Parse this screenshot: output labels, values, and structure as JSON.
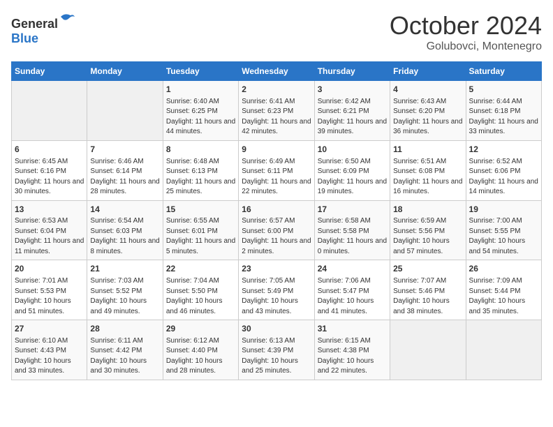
{
  "header": {
    "logo_general": "General",
    "logo_blue": "Blue",
    "month_title": "October 2024",
    "subtitle": "Golubovci, Montenegro"
  },
  "weekdays": [
    "Sunday",
    "Monday",
    "Tuesday",
    "Wednesday",
    "Thursday",
    "Friday",
    "Saturday"
  ],
  "weeks": [
    [
      {
        "day": "",
        "info": ""
      },
      {
        "day": "",
        "info": ""
      },
      {
        "day": "1",
        "info": "Sunrise: 6:40 AM\nSunset: 6:25 PM\nDaylight: 11 hours and 44 minutes."
      },
      {
        "day": "2",
        "info": "Sunrise: 6:41 AM\nSunset: 6:23 PM\nDaylight: 11 hours and 42 minutes."
      },
      {
        "day": "3",
        "info": "Sunrise: 6:42 AM\nSunset: 6:21 PM\nDaylight: 11 hours and 39 minutes."
      },
      {
        "day": "4",
        "info": "Sunrise: 6:43 AM\nSunset: 6:20 PM\nDaylight: 11 hours and 36 minutes."
      },
      {
        "day": "5",
        "info": "Sunrise: 6:44 AM\nSunset: 6:18 PM\nDaylight: 11 hours and 33 minutes."
      }
    ],
    [
      {
        "day": "6",
        "info": "Sunrise: 6:45 AM\nSunset: 6:16 PM\nDaylight: 11 hours and 30 minutes."
      },
      {
        "day": "7",
        "info": "Sunrise: 6:46 AM\nSunset: 6:14 PM\nDaylight: 11 hours and 28 minutes."
      },
      {
        "day": "8",
        "info": "Sunrise: 6:48 AM\nSunset: 6:13 PM\nDaylight: 11 hours and 25 minutes."
      },
      {
        "day": "9",
        "info": "Sunrise: 6:49 AM\nSunset: 6:11 PM\nDaylight: 11 hours and 22 minutes."
      },
      {
        "day": "10",
        "info": "Sunrise: 6:50 AM\nSunset: 6:09 PM\nDaylight: 11 hours and 19 minutes."
      },
      {
        "day": "11",
        "info": "Sunrise: 6:51 AM\nSunset: 6:08 PM\nDaylight: 11 hours and 16 minutes."
      },
      {
        "day": "12",
        "info": "Sunrise: 6:52 AM\nSunset: 6:06 PM\nDaylight: 11 hours and 14 minutes."
      }
    ],
    [
      {
        "day": "13",
        "info": "Sunrise: 6:53 AM\nSunset: 6:04 PM\nDaylight: 11 hours and 11 minutes."
      },
      {
        "day": "14",
        "info": "Sunrise: 6:54 AM\nSunset: 6:03 PM\nDaylight: 11 hours and 8 minutes."
      },
      {
        "day": "15",
        "info": "Sunrise: 6:55 AM\nSunset: 6:01 PM\nDaylight: 11 hours and 5 minutes."
      },
      {
        "day": "16",
        "info": "Sunrise: 6:57 AM\nSunset: 6:00 PM\nDaylight: 11 hours and 2 minutes."
      },
      {
        "day": "17",
        "info": "Sunrise: 6:58 AM\nSunset: 5:58 PM\nDaylight: 11 hours and 0 minutes."
      },
      {
        "day": "18",
        "info": "Sunrise: 6:59 AM\nSunset: 5:56 PM\nDaylight: 10 hours and 57 minutes."
      },
      {
        "day": "19",
        "info": "Sunrise: 7:00 AM\nSunset: 5:55 PM\nDaylight: 10 hours and 54 minutes."
      }
    ],
    [
      {
        "day": "20",
        "info": "Sunrise: 7:01 AM\nSunset: 5:53 PM\nDaylight: 10 hours and 51 minutes."
      },
      {
        "day": "21",
        "info": "Sunrise: 7:03 AM\nSunset: 5:52 PM\nDaylight: 10 hours and 49 minutes."
      },
      {
        "day": "22",
        "info": "Sunrise: 7:04 AM\nSunset: 5:50 PM\nDaylight: 10 hours and 46 minutes."
      },
      {
        "day": "23",
        "info": "Sunrise: 7:05 AM\nSunset: 5:49 PM\nDaylight: 10 hours and 43 minutes."
      },
      {
        "day": "24",
        "info": "Sunrise: 7:06 AM\nSunset: 5:47 PM\nDaylight: 10 hours and 41 minutes."
      },
      {
        "day": "25",
        "info": "Sunrise: 7:07 AM\nSunset: 5:46 PM\nDaylight: 10 hours and 38 minutes."
      },
      {
        "day": "26",
        "info": "Sunrise: 7:09 AM\nSunset: 5:44 PM\nDaylight: 10 hours and 35 minutes."
      }
    ],
    [
      {
        "day": "27",
        "info": "Sunrise: 6:10 AM\nSunset: 4:43 PM\nDaylight: 10 hours and 33 minutes."
      },
      {
        "day": "28",
        "info": "Sunrise: 6:11 AM\nSunset: 4:42 PM\nDaylight: 10 hours and 30 minutes."
      },
      {
        "day": "29",
        "info": "Sunrise: 6:12 AM\nSunset: 4:40 PM\nDaylight: 10 hours and 28 minutes."
      },
      {
        "day": "30",
        "info": "Sunrise: 6:13 AM\nSunset: 4:39 PM\nDaylight: 10 hours and 25 minutes."
      },
      {
        "day": "31",
        "info": "Sunrise: 6:15 AM\nSunset: 4:38 PM\nDaylight: 10 hours and 22 minutes."
      },
      {
        "day": "",
        "info": ""
      },
      {
        "day": "",
        "info": ""
      }
    ]
  ]
}
